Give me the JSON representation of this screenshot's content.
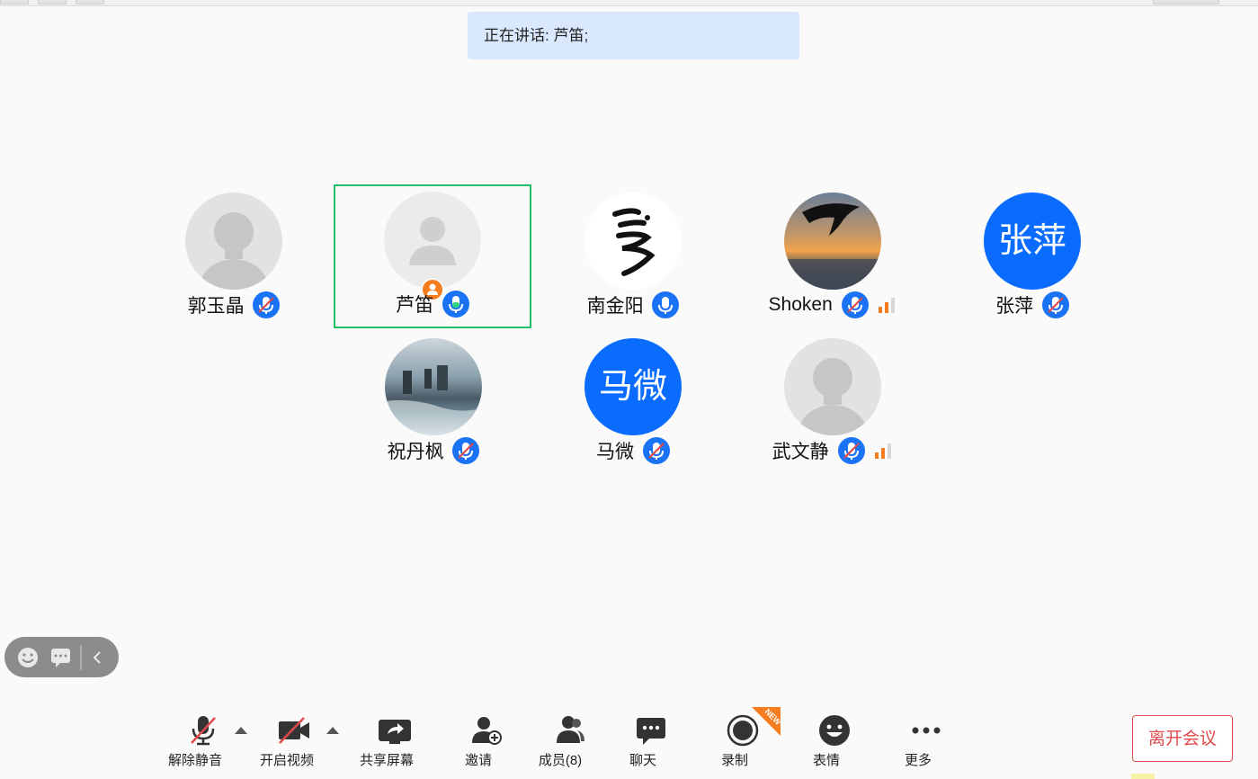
{
  "banner": {
    "speaking": "正在讲话: 芦笛;"
  },
  "participants": [
    {
      "name": "郭玉晶",
      "avatar_kind": "default-gray",
      "muted": true,
      "active": false
    },
    {
      "name": "芦笛",
      "avatar_kind": "default-light",
      "muted": false,
      "active": true,
      "host": true
    },
    {
      "name": "南金阳",
      "avatar_kind": "calligraphy-image",
      "muted": false,
      "active": false
    },
    {
      "name": "Shoken",
      "avatar_kind": "sunset-photo",
      "muted": true,
      "active": false,
      "signal": "weak"
    },
    {
      "name": "张萍",
      "avatar_kind": "initials",
      "avatar_text": "张萍",
      "muted": true,
      "active": false
    },
    {
      "name": "祝丹枫",
      "avatar_kind": "coast-photo",
      "muted": true,
      "active": false
    },
    {
      "name": "马微",
      "avatar_kind": "initials",
      "avatar_text": "马微",
      "muted": true,
      "active": false
    },
    {
      "name": "武文静",
      "avatar_kind": "default-gray",
      "muted": true,
      "active": false,
      "signal": "weak"
    }
  ],
  "toolbar": {
    "unmute": "解除静音",
    "start_video": "开启视频",
    "share_screen": "共享屏幕",
    "invite": "邀请",
    "members": "成员(8)",
    "chat": "聊天",
    "record": "录制",
    "record_badge": "NEW",
    "reactions": "表情",
    "more": "更多",
    "leave": "离开会议"
  },
  "colors": {
    "accent_blue": "#1a73f5",
    "active_border": "#1fbf6a",
    "leave_red": "#e14a4a",
    "banner_bg": "#d9e8fd",
    "signal_orange": "#f57c1f"
  },
  "icons": {
    "unmute": "mic-muted-icon",
    "start_video": "camera-off-icon",
    "share_screen": "share-screen-icon",
    "invite": "add-person-icon",
    "members": "people-icon",
    "chat": "chat-bubble-icon",
    "record": "record-icon",
    "reactions": "smile-icon",
    "more": "more-dots-icon"
  }
}
